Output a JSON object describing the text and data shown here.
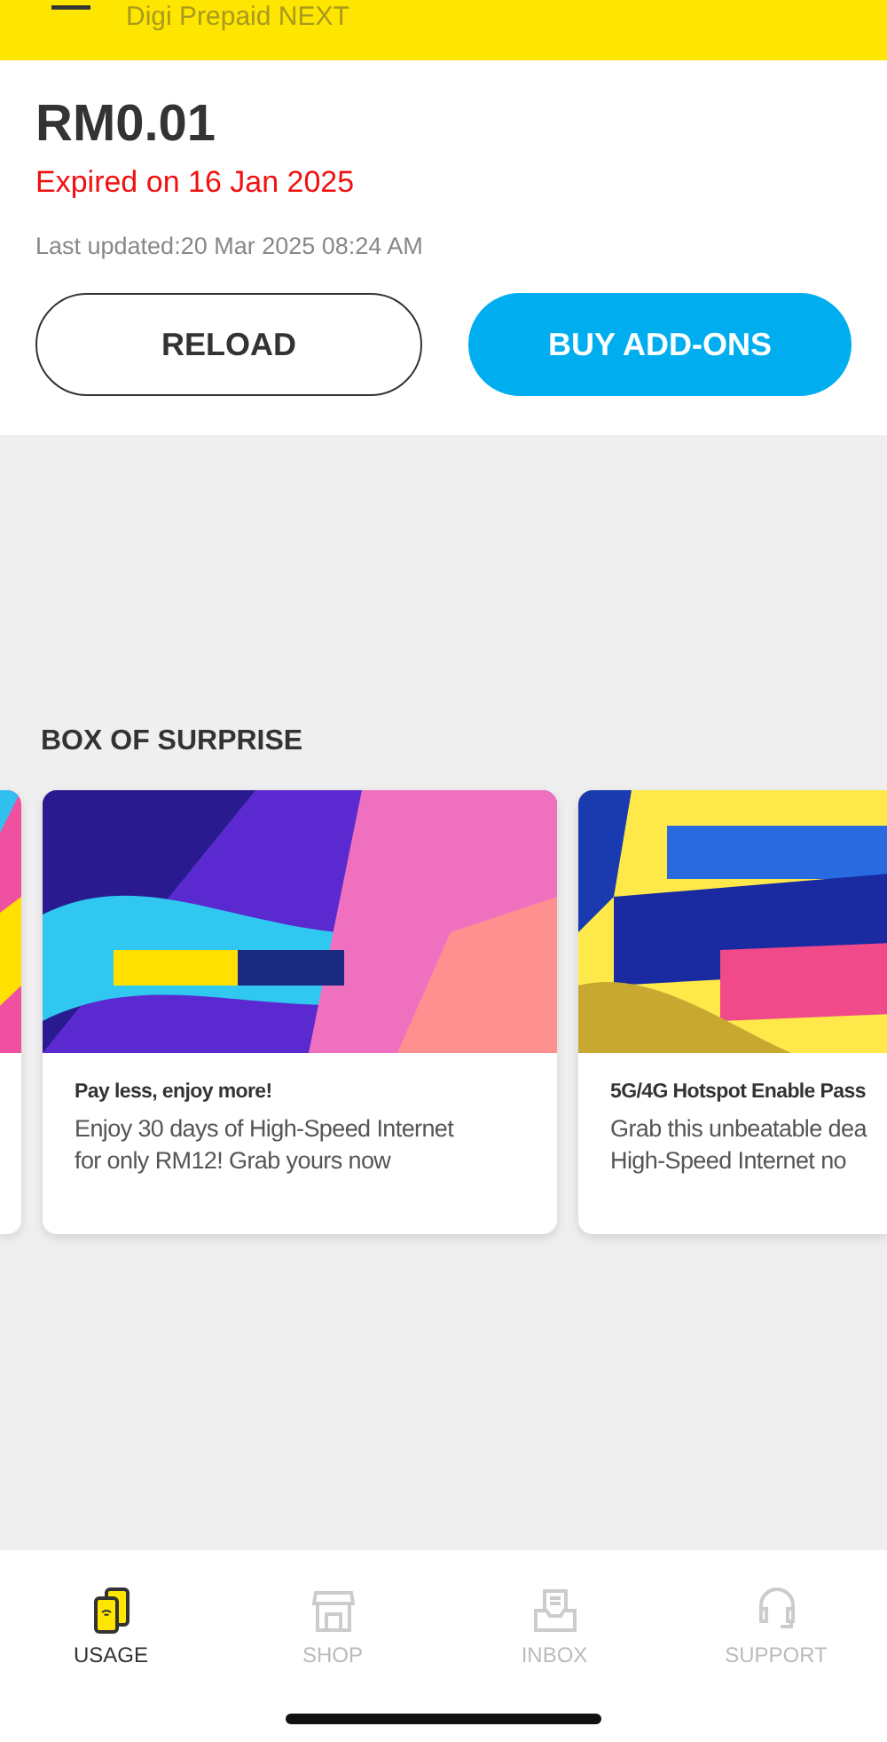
{
  "header": {
    "subtitle": "Digi Prepaid NEXT"
  },
  "balance": {
    "amount": "RM0.01",
    "expiry": "Expired on 16 Jan 2025",
    "updated": "Last updated:20 Mar 2025 08:24 AM"
  },
  "actions": [
    {
      "label": "RELOAD",
      "kind": "outline"
    },
    {
      "label": "BUY ADD-ONS",
      "kind": "filled"
    }
  ],
  "section": {
    "title": "BOX OF SURPRISE"
  },
  "cards": [
    {
      "kind": "partial"
    },
    {
      "kind": "full",
      "title": "Pay less, enjoy more!",
      "lines": [
        "Enjoy 30 days of High-Speed Internet",
        "for only RM12! Grab yours now"
      ]
    },
    {
      "kind": "full",
      "title": "5G/4G Hotspot Enable Pass",
      "lines": [
        "Grab this unbeatable dea",
        "High-Speed Internet no"
      ]
    }
  ],
  "nav": [
    {
      "label": "USAGE",
      "selected": true
    },
    {
      "label": "SHOP",
      "selected": false
    },
    {
      "label": "INBOX",
      "selected": false
    },
    {
      "label": "SUPPORT",
      "selected": false
    }
  ]
}
